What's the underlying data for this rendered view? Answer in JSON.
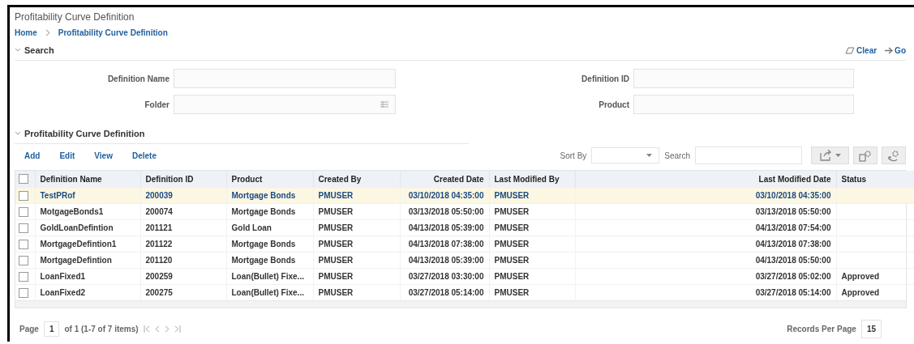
{
  "page_title": "Profitability Curve Definition",
  "breadcrumb": [
    {
      "label": "Home"
    },
    {
      "label": "Profitability Curve Definition"
    }
  ],
  "search_panel": {
    "title": "Search",
    "expanded": true,
    "actions": [
      {
        "label": "Clear",
        "kind": "clear"
      },
      {
        "label": "Go",
        "kind": "go"
      }
    ],
    "fields": [
      {
        "label": "Definition Name",
        "kind": "text"
      },
      {
        "label": "Definition ID",
        "kind": "text"
      },
      {
        "label": "Folder",
        "kind": "picker"
      },
      {
        "label": "Product",
        "kind": "text"
      }
    ]
  },
  "results_panel": {
    "title": "Profitability Curve Definition",
    "expanded": true,
    "actions": [
      {
        "label": "Add"
      },
      {
        "label": "Edit"
      },
      {
        "label": "View"
      },
      {
        "label": "Delete"
      }
    ],
    "sort_label": "Sort By",
    "search_label": "Search"
  },
  "table": {
    "select_all_checked": false,
    "columns": [
      {
        "label": "Definition Name"
      },
      {
        "label": "Definition ID"
      },
      {
        "label": "Product"
      },
      {
        "label": "Created By"
      },
      {
        "label": "Created Date"
      },
      {
        "label": "Last Modified By"
      },
      {
        "label": "Last Modified Date"
      },
      {
        "label": "Status"
      }
    ],
    "rows": [
      {
        "selected": true,
        "checked": false,
        "cells": [
          "TestPRof",
          "200039",
          "Mortgage Bonds",
          "PMUSER",
          "03/10/2018 04:35:00",
          "PMUSER",
          "03/10/2018 04:35:00",
          ""
        ]
      },
      {
        "selected": false,
        "checked": false,
        "cells": [
          "MotgageBonds1",
          "200074",
          "Mortgage Bonds",
          "PMUSER",
          "03/13/2018 05:50:00",
          "PMUSER",
          "03/13/2018 05:50:00",
          ""
        ]
      },
      {
        "selected": false,
        "checked": false,
        "cells": [
          "GoldLoanDefintion",
          "201121",
          "Gold Loan",
          "PMUSER",
          "04/13/2018 05:39:00",
          "PMUSER",
          "04/13/2018 07:54:00",
          ""
        ]
      },
      {
        "selected": false,
        "checked": false,
        "cells": [
          "MortgageDefintion1",
          "201122",
          "Mortgage Bonds",
          "PMUSER",
          "04/13/2018 07:38:00",
          "PMUSER",
          "04/13/2018 07:38:00",
          ""
        ]
      },
      {
        "selected": false,
        "checked": false,
        "cells": [
          "MortgageDefintion",
          "201120",
          "Mortgage Bonds",
          "PMUSER",
          "04/13/2018 05:39:00",
          "PMUSER",
          "04/13/2018 05:50:00",
          ""
        ]
      },
      {
        "selected": false,
        "checked": false,
        "cells": [
          "LoanFixed1",
          "200259",
          "Loan(Bullet) Fixe...",
          "PMUSER",
          "03/27/2018 03:30:00",
          "PMUSER",
          "03/27/2018 05:02:00",
          "Approved"
        ]
      },
      {
        "selected": false,
        "checked": false,
        "cells": [
          "LoanFixed2",
          "200275",
          "Loan(Bullet) Fixe...",
          "PMUSER",
          "03/27/2018 05:14:00",
          "PMUSER",
          "03/27/2018 05:14:00",
          "Approved"
        ]
      }
    ]
  },
  "pager": {
    "page_label": "Page",
    "page_value": "1",
    "summary": "of 1 (1-7 of 7 items)",
    "records_label": "Records Per Page",
    "records_value": "15"
  }
}
